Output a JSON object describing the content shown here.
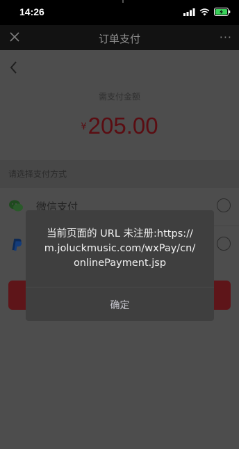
{
  "status_bar": {
    "time": "14:26",
    "icons": [
      "signal-icon",
      "wifi-icon",
      "battery-charging-icon"
    ]
  },
  "navbar": {
    "title": "订单支付",
    "close_icon": "close-icon",
    "more_label": "···"
  },
  "page": {
    "back_icon": "chevron-left-icon",
    "amount_label": "需支付金额",
    "currency_symbol": "¥",
    "amount": "205.00",
    "section_label": "请选择支付方式",
    "methods": [
      {
        "label": "微信支付",
        "icon": "wechat-icon",
        "selected": false
      },
      {
        "label": "PayPal",
        "icon": "paypal-icon",
        "selected": false
      }
    ]
  },
  "dialog": {
    "message_lines": [
      "当前页面的 URL 未注册:https://",
      "m.joluckmusic.com/wxPay/cn/",
      "onlinePayment.jsp"
    ],
    "ok_label": "确定"
  },
  "colors": {
    "amount": "#5a0d12",
    "pay_button": "#5e1519",
    "dialog_bg": "#3f3f3f"
  }
}
